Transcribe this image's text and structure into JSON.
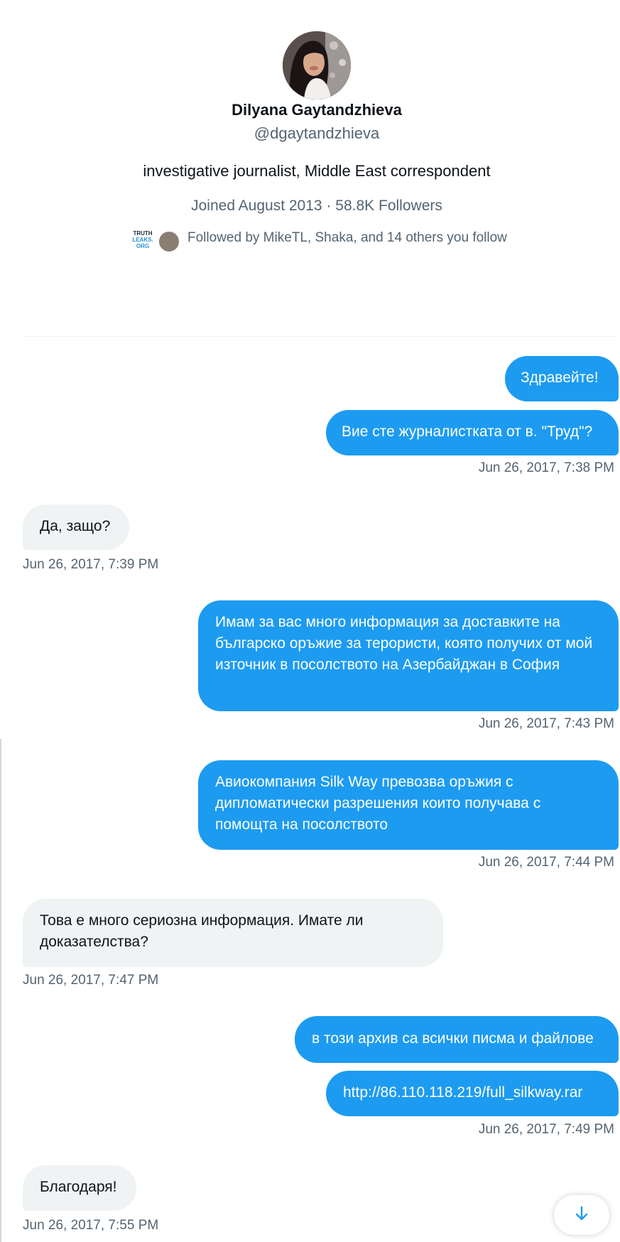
{
  "profile": {
    "name": "Dilyana Gaytandzhieva",
    "handle": "@dgaytandzhieva",
    "bio": "investigative journalist, Middle East correspondent",
    "joined": "Joined August 2013",
    "separator": "·",
    "followers": "58.8K Followers",
    "followed_by": "Followed by MikeTL, Shaka, and 14 others you follow",
    "mini_logo_lines": [
      "TRUTH",
      "LEAKS.",
      "ORG"
    ]
  },
  "messages": [
    {
      "side": "sent",
      "text": "Здравейте!"
    },
    {
      "side": "sent",
      "text": "Вие сте журналистката от в. \"Труд\"?"
    },
    {
      "timestamp": "Jun 26, 2017, 7:38 PM"
    },
    {
      "side": "received",
      "text": "Да, защо?"
    },
    {
      "timestamp": "Jun 26, 2017, 7:39 PM"
    },
    {
      "side": "sent",
      "text": "Имам за вас много информация за доставките на българско оръжие за терористи, която получих от мой източник в посолството на Азербайджан в София"
    },
    {
      "timestamp": "Jun 26, 2017, 7:43 PM"
    },
    {
      "side": "sent",
      "text": "Авиокомпания Silk Way превозва оръжия с дипломатически разрешения които получава с помощта на посолството"
    },
    {
      "timestamp": "Jun 26, 2017, 7:44 PM"
    },
    {
      "side": "received",
      "text": "Това е много сериозна информация. Имате ли доказателства?"
    },
    {
      "timestamp": "Jun 26, 2017, 7:47 PM"
    },
    {
      "side": "sent",
      "text": "в този архив са всички писма и файлове"
    },
    {
      "side": "sent",
      "text": "http://86.110.118.219/full_silkway.rar"
    },
    {
      "timestamp": "Jun 26, 2017, 7:49 PM"
    },
    {
      "side": "received",
      "text": "Благодаря!"
    },
    {
      "timestamp": "Jun 26, 2017, 7:55 PM"
    }
  ],
  "icons": {
    "scroll_down": "arrow-down-icon"
  },
  "colors": {
    "sent_bubble": "#1d9bf0",
    "received_bubble": "#eff3f4",
    "secondary_text": "#536471"
  }
}
